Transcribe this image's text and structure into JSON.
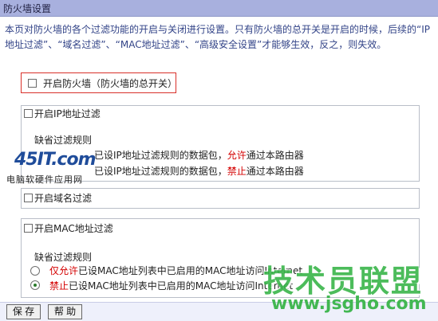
{
  "header": {
    "title": "防火墙设置"
  },
  "intro": "本页对防火墙的各个过滤功能的开启与关闭进行设置。只有防火墙的总开关是开启的时候，后续的“IP地址过滤”、“域名过滤”、“MAC地址过滤”、“高级安全设置”才能够生效，反之，则失效。",
  "firewall": {
    "label": "开启防火墙（防火墙的总开关）",
    "checked": false
  },
  "ip_filter": {
    "label": "开启IP地址过滤",
    "checked": false,
    "default_rule_title": "缺省过滤规则",
    "rule1_prefix": "已设IP地址过滤规则的数据包，",
    "rule1_action": "允许",
    "rule1_suffix": "通过本路由器",
    "rule2_prefix": "已设IP地址过滤规则的数据包，",
    "rule2_action": "禁止",
    "rule2_suffix": "通过本路由器"
  },
  "domain_filter": {
    "label": "开启域名过滤",
    "checked": false
  },
  "mac_filter": {
    "label": "开启MAC地址过滤",
    "checked": false,
    "default_rule_title": "缺省过滤规则",
    "rule1_action": "仅允许",
    "rule1_text": "已设MAC地址列表中已启用的MAC地址访问Internet",
    "rule2_action": "禁止",
    "rule2_text": "已设MAC地址列表中已启用的MAC地址访问Internet",
    "selected_rule": 2
  },
  "buttons": {
    "save": "保 存",
    "help": "帮 助"
  },
  "watermarks": {
    "left_logo": "45IT.com",
    "left_sub": "电脑软硬件应用网",
    "right_cn": "技术员联盟",
    "right_url": "www.jsgho.com"
  },
  "colors": {
    "title_bar": "#a8b0de",
    "highlight_border": "#d9302a",
    "emphasis_red": "#d40000"
  }
}
